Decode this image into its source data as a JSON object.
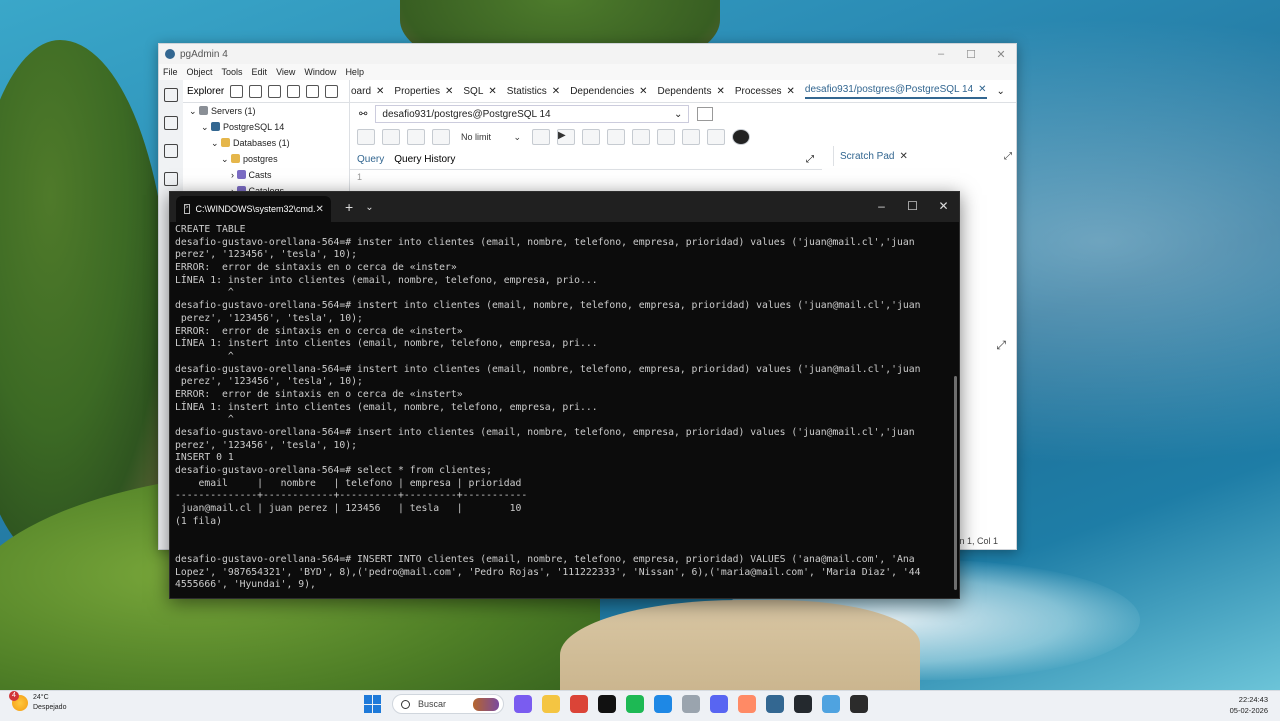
{
  "pgadmin": {
    "title": "pgAdmin 4",
    "menu": [
      "File",
      "Object",
      "Tools",
      "Edit",
      "View",
      "Window",
      "Help"
    ],
    "explorer_label": "Explorer",
    "tree": [
      {
        "label": "Servers (1)",
        "color": "#8a8f96"
      },
      {
        "label": "PostgreSQL 14",
        "color": "#336791"
      },
      {
        "label": "Databases (1)",
        "color": "#e5b64b"
      },
      {
        "label": "postgres",
        "color": "#e5b64b"
      },
      {
        "label": "Casts",
        "color": "#7b6cc4"
      },
      {
        "label": "Catalogs",
        "color": "#7b6cc4"
      }
    ],
    "tabs": [
      "oard",
      "Properties",
      "SQL",
      "Statistics",
      "Dependencies",
      "Dependents",
      "Processes",
      "desafio931/postgres@PostgreSQL 14"
    ],
    "connection": "desafio931/postgres@PostgreSQL 14",
    "no_limit": "No limit",
    "query_tab": "Query",
    "history_tab": "Query History",
    "scratch_pad": "Scratch Pad",
    "line_number": "1",
    "status": "n 1, Col 1"
  },
  "cmd": {
    "tab_title": "C:\\WINDOWS\\system32\\cmd.",
    "lines": [
      "CREATE TABLE",
      "desafio-gustavo-orellana-564=# inster into clientes (email, nombre, telefono, empresa, prioridad) values ('juan@mail.cl','juan",
      "perez', '123456', 'tesla', 10);",
      "ERROR:  error de sintaxis en o cerca de «inster»",
      "LÍNEA 1: inster into clientes (email, nombre, telefono, empresa, prio...",
      "         ^",
      "desafio-gustavo-orellana-564=# instert into clientes (email, nombre, telefono, empresa, prioridad) values ('juan@mail.cl','juan",
      " perez', '123456', 'tesla', 10);",
      "ERROR:  error de sintaxis en o cerca de «instert»",
      "LÍNEA 1: instert into clientes (email, nombre, telefono, empresa, pri...",
      "         ^",
      "desafio-gustavo-orellana-564=# instert into clientes (email, nombre, telefono, empresa, prioridad) values ('juan@mail.cl','juan",
      " perez', '123456', 'tesla', 10);",
      "ERROR:  error de sintaxis en o cerca de «instert»",
      "LÍNEA 1: instert into clientes (email, nombre, telefono, empresa, pri...",
      "         ^",
      "desafio-gustavo-orellana-564=# insert into clientes (email, nombre, telefono, empresa, prioridad) values ('juan@mail.cl','juan",
      "perez', '123456', 'tesla', 10);",
      "INSERT 0 1",
      "desafio-gustavo-orellana-564=# select * from clientes;",
      "    email     |   nombre   | telefono | empresa | prioridad",
      "--------------+------------+----------+---------+-----------",
      " juan@mail.cl | juan perez | 123456   | tesla   |        10",
      "(1 fila)",
      "",
      "",
      "desafio-gustavo-orellana-564=# INSERT INTO clientes (email, nombre, telefono, empresa, prioridad) VALUES ('ana@mail.com', 'Ana",
      "Lopez', '987654321', 'BYD', 8),('pedro@mail.com', 'Pedro Rojas', '111222333', 'Nissan', 6),('maria@mail.com', 'Maria Diaz', '44",
      "4555666', 'Hyundai', 9),"
    ]
  },
  "taskbar": {
    "weather_temp": "24°C",
    "weather_desc": "Despejado",
    "weather_badge": "4",
    "search_placeholder": "Buscar",
    "time": "22:24:43",
    "date": "05-02-2026",
    "apps": [
      {
        "name": "copilot",
        "color": "#7a5cf0"
      },
      {
        "name": "file-explorer",
        "color": "#f4c542"
      },
      {
        "name": "chrome",
        "color": "#db4437"
      },
      {
        "name": "notion",
        "color": "#111111"
      },
      {
        "name": "spotify",
        "color": "#1db954"
      },
      {
        "name": "vscode",
        "color": "#1e88e5"
      },
      {
        "name": "database",
        "color": "#9aa4ae"
      },
      {
        "name": "discord",
        "color": "#5865f2"
      },
      {
        "name": "paint",
        "color": "#ff8a65"
      },
      {
        "name": "pgadmin",
        "color": "#336791"
      },
      {
        "name": "github",
        "color": "#24292e"
      },
      {
        "name": "notepad",
        "color": "#4fa3e0"
      },
      {
        "name": "terminal",
        "color": "#2b2b2b"
      }
    ]
  },
  "colors": {
    "pg_accent": "#326690",
    "terminal_bg": "#0c0c0c",
    "terminal_text": "#cccccc"
  }
}
